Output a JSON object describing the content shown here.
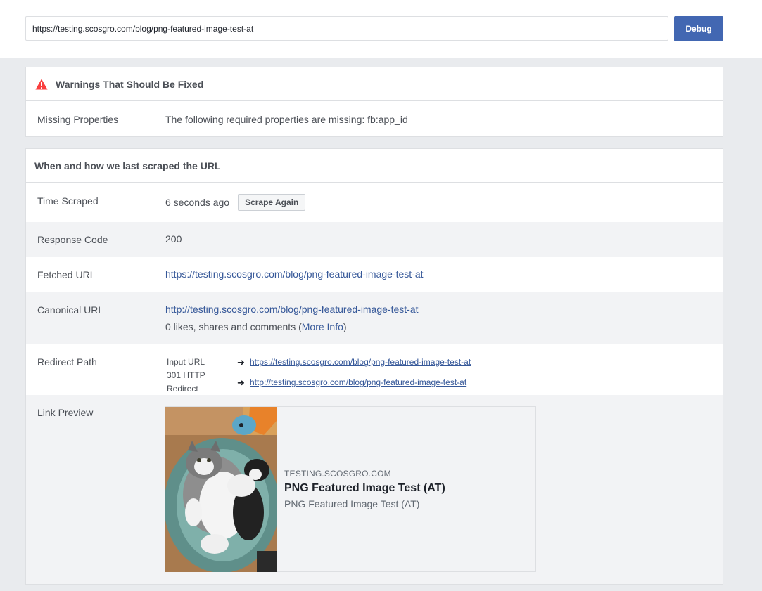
{
  "search": {
    "url_value": "https://testing.scosgro.com/blog/png-featured-image-test-at",
    "debug_label": "Debug"
  },
  "warnings": {
    "title": "Warnings That Should Be Fixed",
    "row_label": "Missing Properties",
    "row_value": "The following required properties are missing: fb:app_id"
  },
  "scrape": {
    "title": "When and how we last scraped the URL",
    "time_label": "Time Scraped",
    "time_value": "6 seconds ago",
    "scrape_again_label": "Scrape Again",
    "response_label": "Response Code",
    "response_value": "200",
    "fetched_label": "Fetched URL",
    "fetched_value": "https://testing.scosgro.com/blog/png-featured-image-test-at",
    "canonical_label": "Canonical URL",
    "canonical_value": "http://testing.scosgro.com/blog/png-featured-image-test-at",
    "engagement_prefix": "0 likes, shares and comments (",
    "more_info_label": "More Info",
    "engagement_suffix": ")",
    "redirect_label": "Redirect Path",
    "redirects": [
      {
        "label": "Input URL",
        "url": "https://testing.scosgro.com/blog/png-featured-image-test-at"
      },
      {
        "label": "301 HTTP Redirect",
        "url": "http://testing.scosgro.com/blog/png-featured-image-test-at"
      }
    ],
    "preview_label": "Link Preview",
    "preview": {
      "domain": "TESTING.SCOSGRO.COM",
      "title": "PNG Featured Image Test (AT)",
      "description": "PNG Featured Image Test (AT)"
    }
  },
  "icons": {
    "warning": "warning-triangle-icon",
    "arrow": "arrow-right-icon"
  },
  "colors": {
    "accent": "#4267b2",
    "link": "#365899",
    "warning": "#fa3e3e",
    "background": "#e9ebee",
    "row_alt": "#f2f3f5"
  }
}
